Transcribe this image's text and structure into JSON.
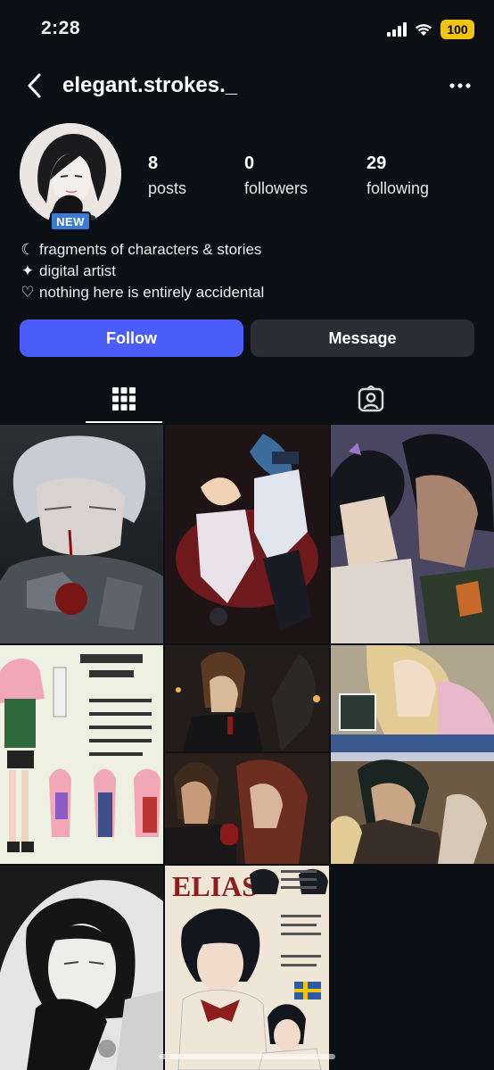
{
  "status_bar": {
    "time": "2:28",
    "battery": "100",
    "battery_color": "#f1c40f"
  },
  "header": {
    "username": "elegant.strokes._",
    "back_icon": "chevron-left-icon",
    "more_icon": "more-horizontal-icon"
  },
  "profile": {
    "badge": "NEW",
    "stats": [
      {
        "value": "8",
        "label": "posts"
      },
      {
        "value": "0",
        "label": "followers"
      },
      {
        "value": "29",
        "label": "following"
      }
    ],
    "bio": [
      {
        "icon": "moon-icon",
        "glyph": "☾",
        "text": "fragments of characters & stories"
      },
      {
        "icon": "sparkle-icon",
        "glyph": "✦",
        "text": "digital artist"
      },
      {
        "icon": "heart-outline-icon",
        "glyph": "♡",
        "text": "nothing here is entirely accidental"
      }
    ]
  },
  "actions": {
    "follow_label": "Follow",
    "message_label": "Message",
    "follow_color": "#4a5df9",
    "message_color": "#2a2d33"
  },
  "tabs": [
    {
      "name": "grid",
      "icon": "grid-icon",
      "active": true
    },
    {
      "name": "tagged",
      "icon": "tagged-person-icon",
      "active": false
    }
  ],
  "grid_images": {
    "posts": [
      {
        "title": "",
        "theme": "white-haired wounded knight",
        "colors": [
          "#1d2226",
          "#6c7078",
          "#b8bcc4",
          "#7a1111"
        ]
      },
      {
        "title": "",
        "theme": "alice in wonderland duo on red",
        "colors": [
          "#221617",
          "#5a1b1d",
          "#c9c7d3",
          "#2b4a6a"
        ]
      },
      {
        "title": "",
        "theme": "couple kiss, purple butterflies",
        "colors": [
          "#433f56",
          "#1a1b24",
          "#d9c3b0",
          "#8d6b9f"
        ]
      },
      {
        "title": "",
        "theme": "character sheet Mars",
        "colors": [
          "#eef0e3",
          "#f2a9b9",
          "#2f6a3f",
          "#3b3d5c"
        ]
      },
      {
        "title": "",
        "theme": "candlelit dinner two panels",
        "colors": [
          "#1d1a18",
          "#5b3a24",
          "#a86a35",
          "#2e2a2a"
        ]
      },
      {
        "title": "",
        "theme": "blonde girl, facebook page",
        "colors": [
          "#8a93a3",
          "#d7c39a",
          "#2f3b52",
          "#c5ccd8"
        ]
      },
      {
        "title": "",
        "theme": "dark-haired girl grayscale",
        "colors": [
          "#1b1b1b",
          "#8e8e8e",
          "#d9d9d9",
          "#444"
        ]
      },
      {
        "title": "ELIAS",
        "theme": "character sheet Elias",
        "colors": [
          "#efe6d7",
          "#1a1c24",
          "#8d1e1e",
          "#c5a66b"
        ]
      }
    ]
  }
}
